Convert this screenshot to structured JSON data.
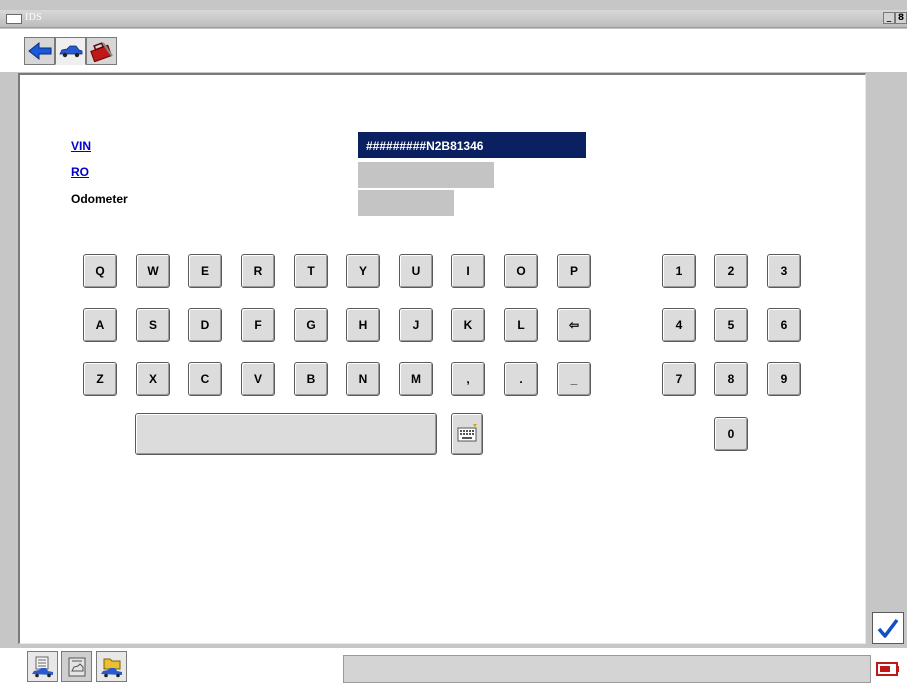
{
  "window": {
    "title": "IDS",
    "minimize": "_",
    "restore": "8"
  },
  "toolbar": {
    "icons": [
      "back-arrow-icon",
      "vehicle-icon",
      "toolbox-icon"
    ]
  },
  "form": {
    "vin_label": "VIN",
    "ro_label": "RO",
    "odometer_label": "Odometer",
    "vin_value": "#########N2B81346",
    "ro_value": "",
    "odometer_value": ""
  },
  "keyboard": {
    "row1": [
      "Q",
      "W",
      "E",
      "R",
      "T",
      "Y",
      "U",
      "I",
      "O",
      "P"
    ],
    "row2": [
      "A",
      "S",
      "D",
      "F",
      "G",
      "H",
      "J",
      "K",
      "L",
      "⇦"
    ],
    "row3": [
      "Z",
      "X",
      "C",
      "V",
      "B",
      "N",
      "M",
      ",",
      ".",
      "_"
    ],
    "numpad": [
      "1",
      "2",
      "3",
      "4",
      "5",
      "6",
      "7",
      "8",
      "9",
      "0"
    ]
  },
  "colors": {
    "selected_field": "#0a2060",
    "link": "#0000cc",
    "check": "#1050c0"
  },
  "statusbar": {
    "text": ""
  }
}
